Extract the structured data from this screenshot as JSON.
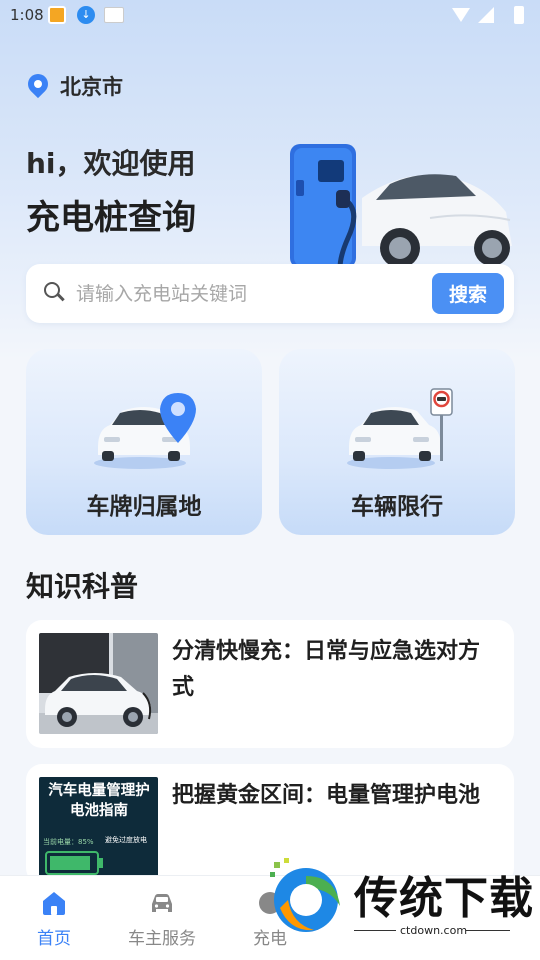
{
  "status_bar": {
    "time": "1:08"
  },
  "location": {
    "city": "北京市"
  },
  "hero": {
    "greeting": "hi，欢迎使用",
    "headline": "充电桩查询"
  },
  "search": {
    "placeholder": "请输入充电站关键词",
    "value": "",
    "button_label": "搜索"
  },
  "features": [
    {
      "label": "车牌归属地",
      "icon": "car-location-icon"
    },
    {
      "label": "车辆限行",
      "icon": "car-no-entry-icon"
    }
  ],
  "knowledge": {
    "section_title": "知识科普",
    "articles": [
      {
        "title": "分清快慢充：日常与应急选对方式",
        "thumb": "ev-charging-photo"
      },
      {
        "title": "把握黄金区间：电量管理护电池",
        "thumb_title": "汽车电量管理护电池指南",
        "thumb_meta": "当前电量：85%",
        "thumb_tag": "避免过度放电"
      }
    ]
  },
  "bottom_nav": {
    "items": [
      {
        "label": "首页",
        "icon": "home-icon",
        "active": true
      },
      {
        "label": "车主服务",
        "icon": "car-icon",
        "active": false
      },
      {
        "label": "充电",
        "icon": "charge-icon",
        "active": false
      }
    ]
  },
  "watermark": {
    "brand": "传统下载",
    "url": "ctdown.com"
  },
  "colors": {
    "accent": "#3b82f6",
    "button": "#4b90f4",
    "background": "#f3f6fb"
  }
}
